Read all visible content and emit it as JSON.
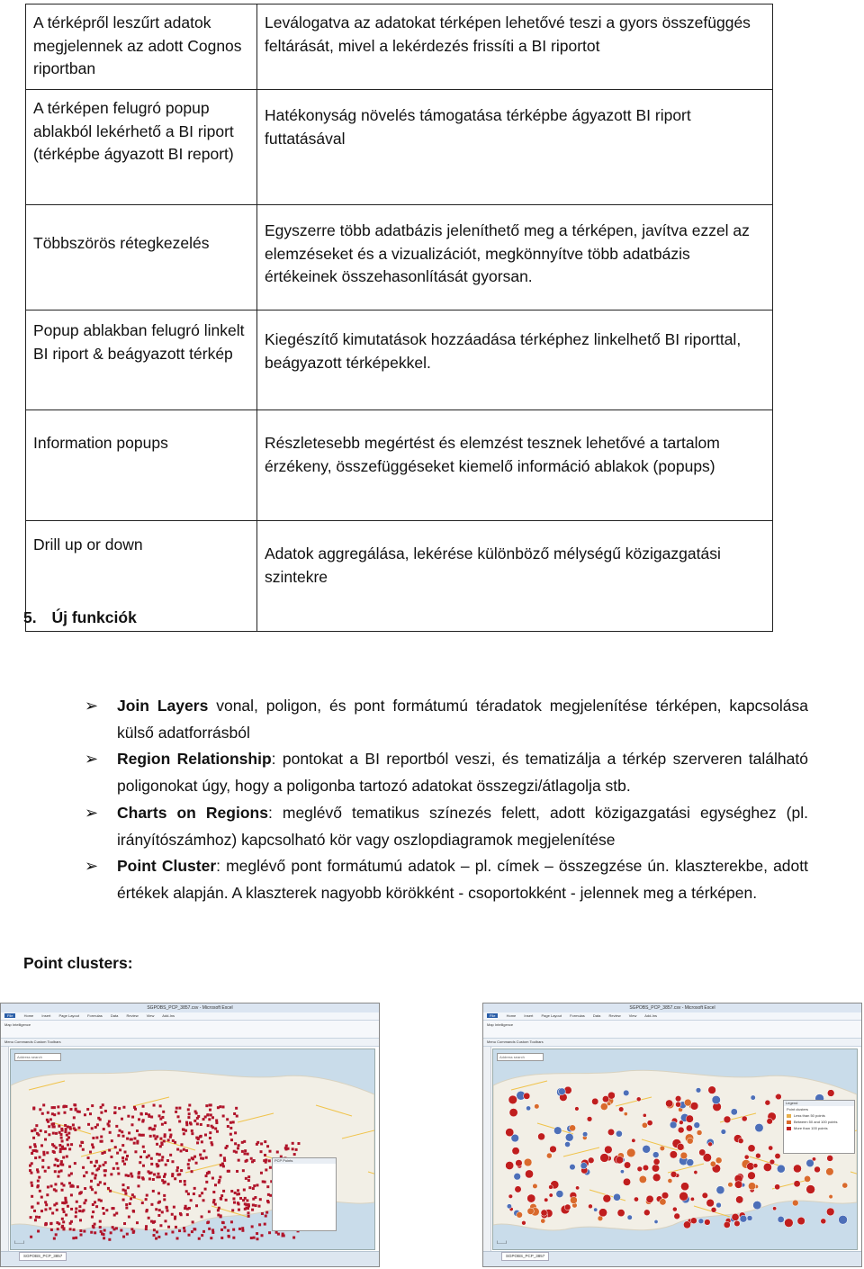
{
  "table": {
    "rows": [
      {
        "feature": "A térképről leszűrt adatok megjelennek az adott Cognos riportban",
        "description": "Leválogatva az adatokat térképen lehetővé teszi a gyors összefüggés feltárását, mivel a lekérdezés frissíti a BI riportot"
      },
      {
        "feature": "A térképen felugró popup ablakból lekérhető a BI riport (térképbe ágyazott BI report)",
        "description": "Hatékonyság növelés támogatása térképbe ágyazott BI riport futtatásával"
      },
      {
        "feature": "Többszörös rétegkezelés",
        "description": "Egyszerre több adatbázis jeleníthető meg a térképen, javítva ezzel az elemzéseket és a vizualizációt, megkönnyítve több adatbázis értékeinek összehasonlítását gyorsan."
      },
      {
        "feature": "Popup ablakban felugró linkelt BI riport & beágyazott térkép",
        "description": "Kiegészítő kimutatások hozzáadása térképhez linkelhető BI riporttal, beágyazott térképekkel."
      },
      {
        "feature": "Information popups",
        "description": "Részletesebb megértést és elemzést tesznek lehetővé a tartalom érzékeny, összefüggéseket kiemelő információ ablakok (popups)"
      },
      {
        "feature": "Drill up or down",
        "description": "Adatok aggregálása, lekérése különböző mélységű közigazgatási szintekre"
      }
    ]
  },
  "section": {
    "number": "5.",
    "title": "Új funkciók"
  },
  "bullets": [
    {
      "term": "Join Layers",
      "text": " vonal, poligon, és pont formátumú téradatok megjelenítése térképen, kapcsolása külső adatforrásból"
    },
    {
      "term": "Region Relationship",
      "text": ": pontokat a BI reportból veszi, és tematizálja a térkép szerveren található poligonokat úgy, hogy a poligonba tartozó adatokat összegzi/átlagolja stb."
    },
    {
      "term": "Charts on Regions",
      "text": ": meglévő tematikus színezés felett, adott közigazgatási egységhez (pl. irányítószámhoz) kapcsolható kör vagy oszlopdiagramok megjelenítése"
    },
    {
      "term": "Point Cluster",
      "text": ": meglévő pont formátumú adatok – pl. címek – összegzése ún. klaszterekbe, adott értékek alapján. A klaszterek nagyobb körökként - csoportokként - jelennek meg a térképen."
    }
  ],
  "bullet_icon": "arrow-bullet-icon",
  "point_clusters_label": "Point clusters:",
  "screenshots": {
    "left": {
      "window_title": "SGPOBS_PCP_3857.csv - Microsoft Excel",
      "tabs": [
        "File",
        "Home",
        "Insert",
        "Page Layout",
        "Formulas",
        "Data",
        "Review",
        "View",
        "Add-Ins"
      ],
      "ribbon_label": "Map Intelligence",
      "toolbar_label": "Menu Commands    Custom Toolbars",
      "search_placeholder": "Address search",
      "popup_title": "PCP Points",
      "sheet_tab": "SGPOBS_PCP_3857",
      "marker_color": "#b0142a"
    },
    "right": {
      "window_title": "SGPOBS_PCP_3857.csv - Microsoft Excel",
      "tabs": [
        "File",
        "Home",
        "Insert",
        "Page Layout",
        "Formulas",
        "Data",
        "Review",
        "View",
        "Add-Ins"
      ],
      "ribbon_label": "Map Intelligence",
      "toolbar_label": "Menu Commands    Custom Toolbars",
      "search_placeholder": "Address search",
      "sheet_tab": "SGPOBS_PCP_3857",
      "legend": {
        "title": "Legend",
        "subtitle": "Point clusters",
        "items": [
          {
            "label": "Less than 50 points",
            "color": "#e8b04a"
          },
          {
            "label": "Between 50 and 100 points",
            "color": "#d96a2c"
          },
          {
            "label": "More than 100 points",
            "color": "#c01e1e"
          }
        ]
      },
      "cluster_colors": [
        "#c01e1e",
        "#d96a2c",
        "#4d6fb8"
      ]
    }
  }
}
